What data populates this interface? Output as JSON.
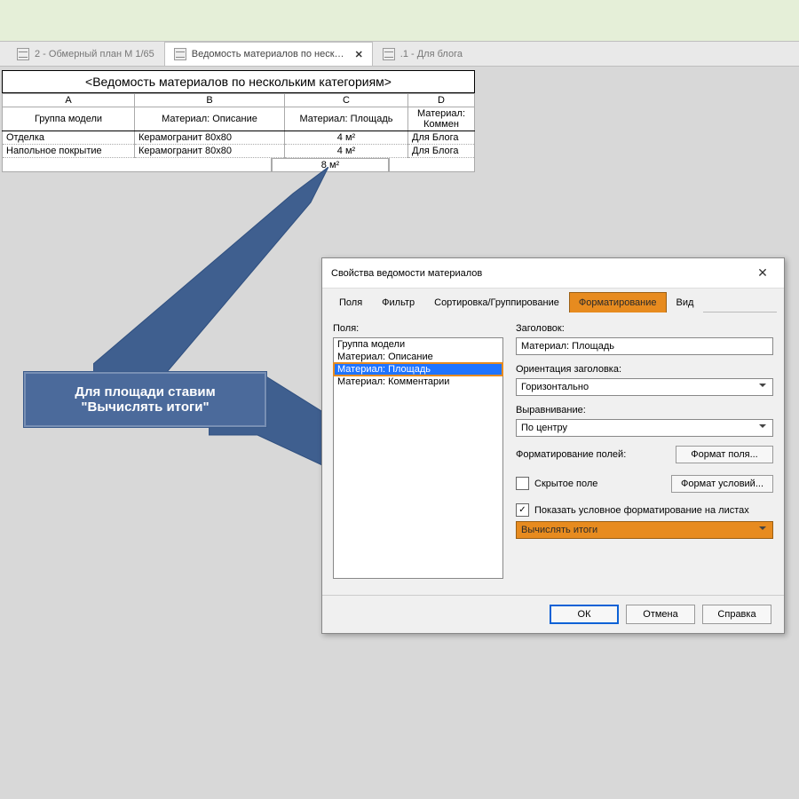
{
  "tabs": {
    "t1": "2 - Обмерный план М 1/65",
    "t2": "Ведомость материалов по неск…",
    "t3": ".1 - Для блога"
  },
  "schedule": {
    "title": "<Ведомость материалов по нескольким категориям>",
    "cols": {
      "a": "A",
      "b": "B",
      "c": "C",
      "d": "D"
    },
    "head": {
      "a": "Группа модели",
      "b": "Материал: Описание",
      "c": "Материал: Площадь",
      "d": "Материал: Коммен"
    },
    "rows": [
      {
        "a": "Отделка",
        "b": "Керамогранит 80х80",
        "c": "4 м²",
        "d": "Для Блога"
      },
      {
        "a": "Напольное покрытие",
        "b": "Керамогранит 80х80",
        "c": "4 м²",
        "d": "Для Блога"
      }
    ],
    "total": "8 м²"
  },
  "callout": {
    "line1": "Для площади ставим",
    "line2": "\"Вычислять итоги\""
  },
  "dialog": {
    "title": "Свойства ведомости материалов",
    "tabs": {
      "t1": "Поля",
      "t2": "Фильтр",
      "t3": "Сортировка/Группирование",
      "t4": "Форматирование",
      "t5": "Вид"
    },
    "fields_label": "Поля:",
    "fields": [
      "Группа модели",
      "Материал: Описание",
      "Материал: Площадь",
      "Материал: Комментарии"
    ],
    "heading_label": "Заголовок:",
    "heading_value": "Материал: Площадь",
    "orient_label": "Ориентация заголовка:",
    "orient_value": "Горизонтально",
    "align_label": "Выравнивание:",
    "align_value": "По центру",
    "fmt_label": "Форматирование полей:",
    "btn_field": "Формат поля...",
    "btn_cond": "Формат условий...",
    "hidden": "Скрытое поле",
    "show_cond": "Показать условное форматирование на листах",
    "totals": "Вычислять итоги",
    "ok": "ОК",
    "cancel": "Отмена",
    "help": "Справка"
  }
}
